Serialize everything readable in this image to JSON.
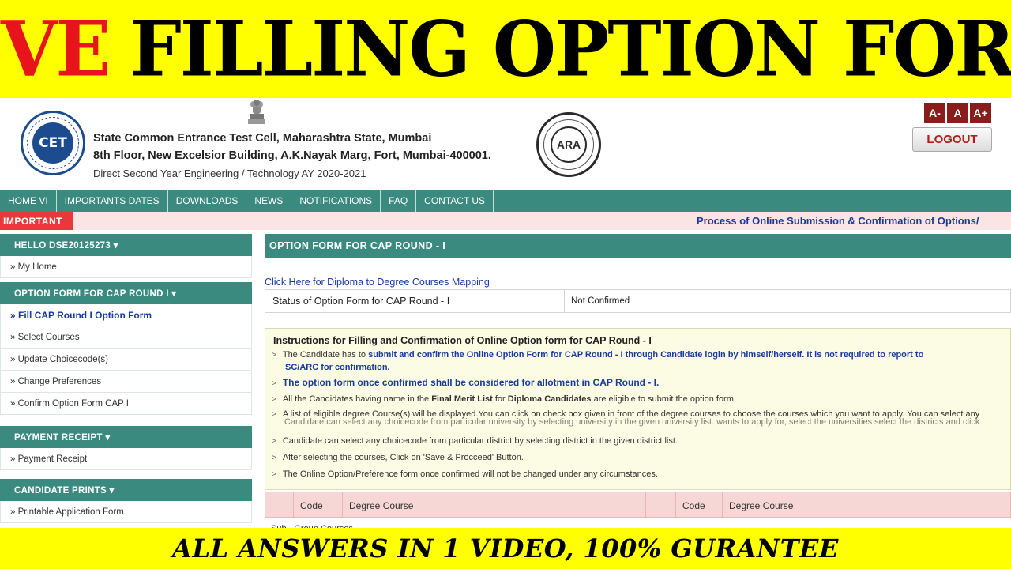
{
  "banner": {
    "live": "LIVE",
    "title": "FILLING OPTION FORM",
    "bottom": "ALL ANSWERS IN 1 VIDEO, 100% GURANTEE"
  },
  "header": {
    "cet_logo_text": "CET",
    "ara_logo_text": "ARA",
    "org_line1": "State Common Entrance Test Cell, Maharashtra State, Mumbai",
    "org_line2": "8th Floor, New Excelsior Building, A.K.Nayak Marg, Fort, Mumbai-400001.",
    "org_line3": "Direct Second Year Engineering / Technology AY 2020-2021",
    "font_small": "A-",
    "font_normal": "A",
    "font_large": "A+",
    "logout": "LOGOUT"
  },
  "nav": {
    "items": [
      "HOME VI",
      "IMPORTANTS DATES",
      "DOWNLOADS",
      "NEWS",
      "NOTIFICATIONS",
      "FAQ",
      "CONTACT US"
    ]
  },
  "important": {
    "tag": "IMPORTANT",
    "marquee": "Process of Online Submission & Confirmation of Options/"
  },
  "sidebar": {
    "hello": "HELLO DSE20125273 ▾",
    "my_home": "» My Home",
    "option_head": "OPTION FORM FOR CAP ROUND I ▾",
    "fill": "» Fill CAP Round I Option Form",
    "select": "» Select Courses",
    "update": "» Update Choicecode(s)",
    "change": "» Change Preferences",
    "confirm": "» Confirm Option Form CAP I",
    "payment_head": "PAYMENT RECEIPT ▾",
    "payment": "» Payment Receipt",
    "prints_head": "CANDIDATE PRINTS ▾",
    "printable": "» Printable Application Form"
  },
  "main": {
    "title": "OPTION FORM FOR CAP ROUND - I",
    "mapping_link": "Click Here for Diploma to Degree Courses Mapping",
    "status_label": "Status of Option Form for CAP Round - I",
    "status_value": "Not Confirmed",
    "instructions": {
      "title": "Instructions for Filling and Confirmation of Online Option form for CAP Round - I",
      "i1_pre": "The Candidate has to ",
      "i1_bold": "submit and confirm the Online Option Form for CAP Round - I through Candidate login by himself/herself. It is not required to report to",
      "i1_bold2": "SC/ARC for confirmation.",
      "i2": "The option form once confirmed shall be considered for allotment in CAP Round - I.",
      "i3_pre": "All the Candidates having name in the ",
      "i3_b1": "Final Merit List",
      "i3_mid": " for ",
      "i3_b2": "Diploma Candidates",
      "i3_post": " are eligible to submit the option form.",
      "i4": "A list of eligible degree Course(s) will be displayed.You can click on check box given in front of the degree courses to choose the courses which you want to apply. You can select any",
      "i4_overlap": "Candidate can select any choicecode from particular university by selecting university in the given university list.        wants to apply for, select the universities select the districts and click",
      "i5": "Candidate can select any choicecode from particular district by selecting district in the given district list.",
      "i6": "After selecting the courses, Click on 'Save & Procceed' Button.",
      "i7": "The Online Option/Preference form once confirmed will not be changed under any circumstances."
    },
    "course_cols": {
      "code": "Code",
      "degree": "Degree Course"
    },
    "sub_row": "Sub - Group Courses"
  }
}
